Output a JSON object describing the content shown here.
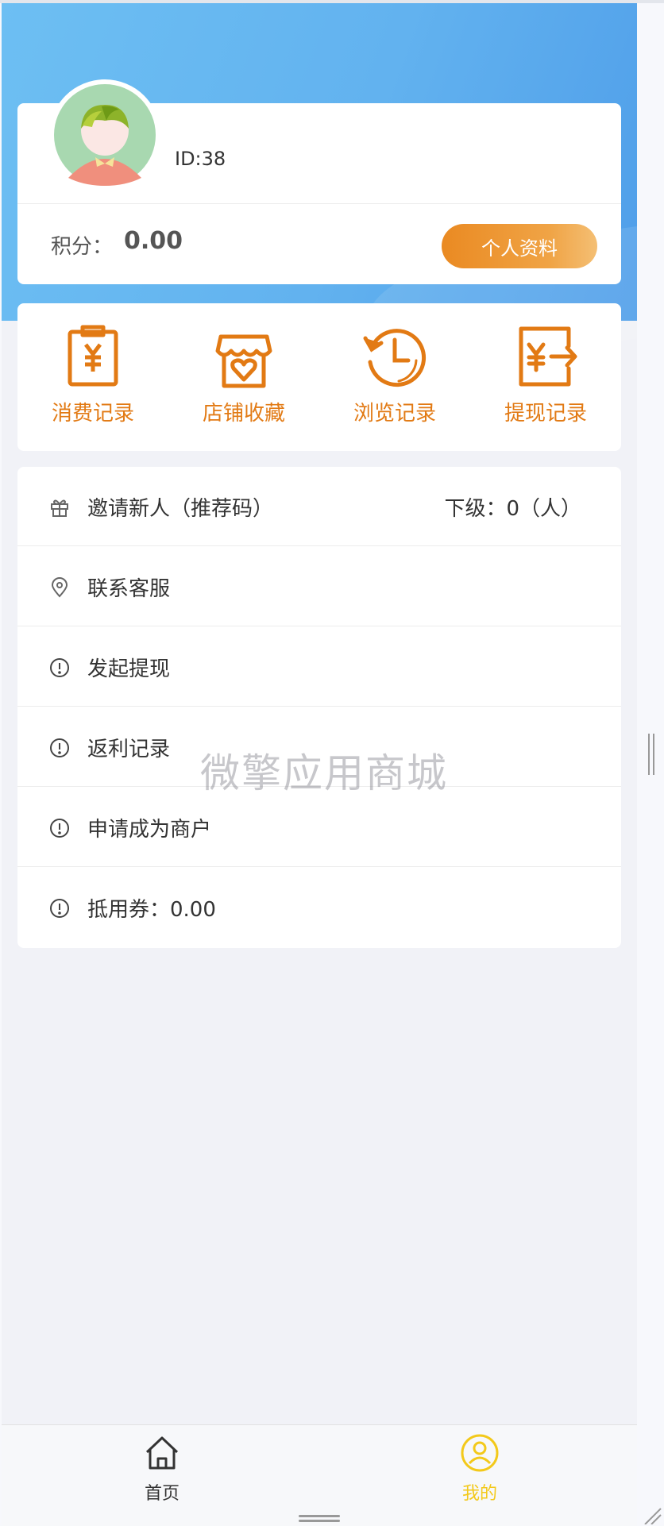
{
  "user": {
    "id_text": "ID:38",
    "points_label": "积分：",
    "points_value": "0.00",
    "profile_button": "个人资料"
  },
  "quick_actions": [
    {
      "label": "消费记录",
      "icon": "receipt-yen-icon"
    },
    {
      "label": "店铺收藏",
      "icon": "store-heart-icon"
    },
    {
      "label": "浏览记录",
      "icon": "history-clock-icon"
    },
    {
      "label": "提现记录",
      "icon": "withdraw-yen-icon"
    }
  ],
  "menu": [
    {
      "label": "邀请新人（推荐码）",
      "right": "下级：0（人）",
      "icon": "gift-icon"
    },
    {
      "label": "联系客服",
      "icon": "location-pin-icon"
    },
    {
      "label": "发起提现",
      "icon": "info-circle-icon"
    },
    {
      "label": "返利记录",
      "icon": "info-circle-icon"
    },
    {
      "label": "申请成为商户",
      "icon": "info-circle-icon"
    },
    {
      "label": "抵用券：0.00",
      "icon": "info-circle-icon"
    }
  ],
  "watermark": "微擎应用商城",
  "tabbar": [
    {
      "label": "首页",
      "icon": "home-icon",
      "active": false
    },
    {
      "label": "我的",
      "icon": "user-circle-icon",
      "active": true
    }
  ],
  "colors": {
    "header_blue": "#62b2ef",
    "accent_orange": "#e27a14",
    "active_tab": "#f3c91a"
  }
}
